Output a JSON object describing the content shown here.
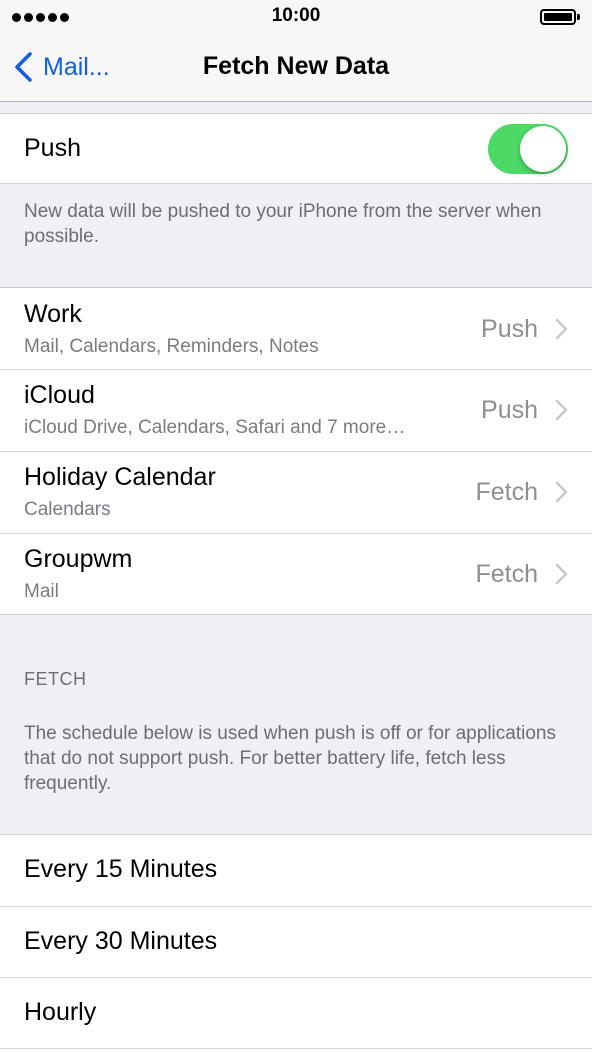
{
  "status_bar": {
    "time": "10:00",
    "signal_bars": 5,
    "battery_level": 1.0
  },
  "nav": {
    "back_label": "Mail...",
    "title": "Fetch New Data"
  },
  "push": {
    "label": "Push",
    "enabled": true,
    "toggle_color": "#4cd964",
    "footer": "New data will be pushed to your iPhone from the server when possible."
  },
  "accounts": [
    {
      "name": "Work",
      "detail": "Mail, Calendars, Reminders, Notes",
      "value": "Push"
    },
    {
      "name": "iCloud",
      "detail": "iCloud Drive, Calendars, Safari and 7 more…",
      "value": "Push"
    },
    {
      "name": "Holiday Calendar",
      "detail": "Calendars",
      "value": "Fetch"
    },
    {
      "name": "Groupwm",
      "detail": "Mail",
      "value": "Fetch"
    }
  ],
  "fetch": {
    "header": "FETCH",
    "description": "The schedule below is used when push is off or for applications that do not support push. For better battery life, fetch less frequently.",
    "options": [
      {
        "label": "Every 15 Minutes"
      },
      {
        "label": "Every 30 Minutes"
      },
      {
        "label": "Hourly"
      }
    ]
  },
  "colors": {
    "accent": "#0e5fe3",
    "background": "#efeff4"
  }
}
